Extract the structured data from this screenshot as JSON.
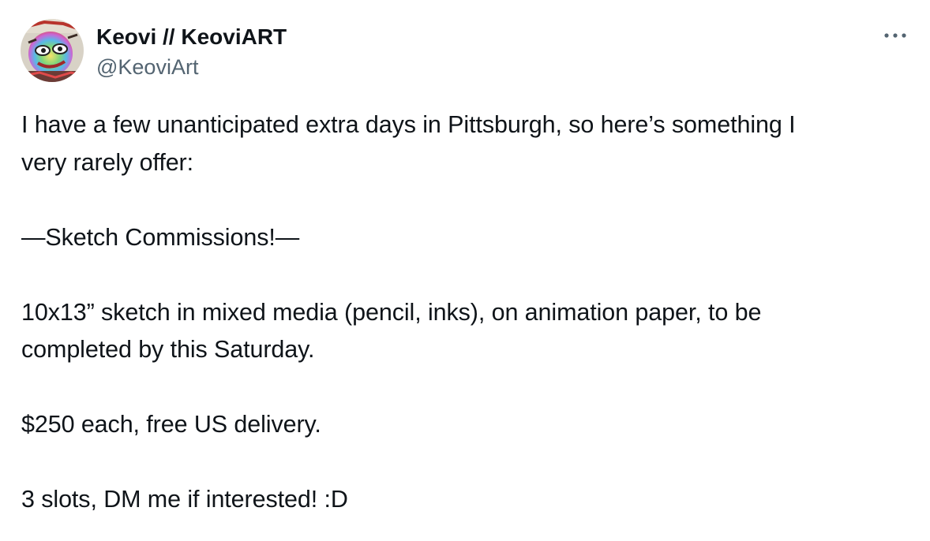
{
  "author": {
    "display_name": "Keovi // KeoviART",
    "handle": "@KeoviArt",
    "avatar_icon": "avatar-artwork"
  },
  "menu": {
    "icon": "more-horizontal-icon"
  },
  "tweet": {
    "lines": [
      "I have a few unanticipated extra days in Pittsburgh, so here’s something I",
      "very rarely offer:",
      "",
      "—Sketch Commissions!—",
      "",
      "10x13” sketch in mixed media (pencil, inks), on animation paper, to be",
      "completed by this Saturday.",
      "",
      "$250 each, free US delivery.",
      "",
      "3 slots, DM me if interested! :D"
    ]
  }
}
